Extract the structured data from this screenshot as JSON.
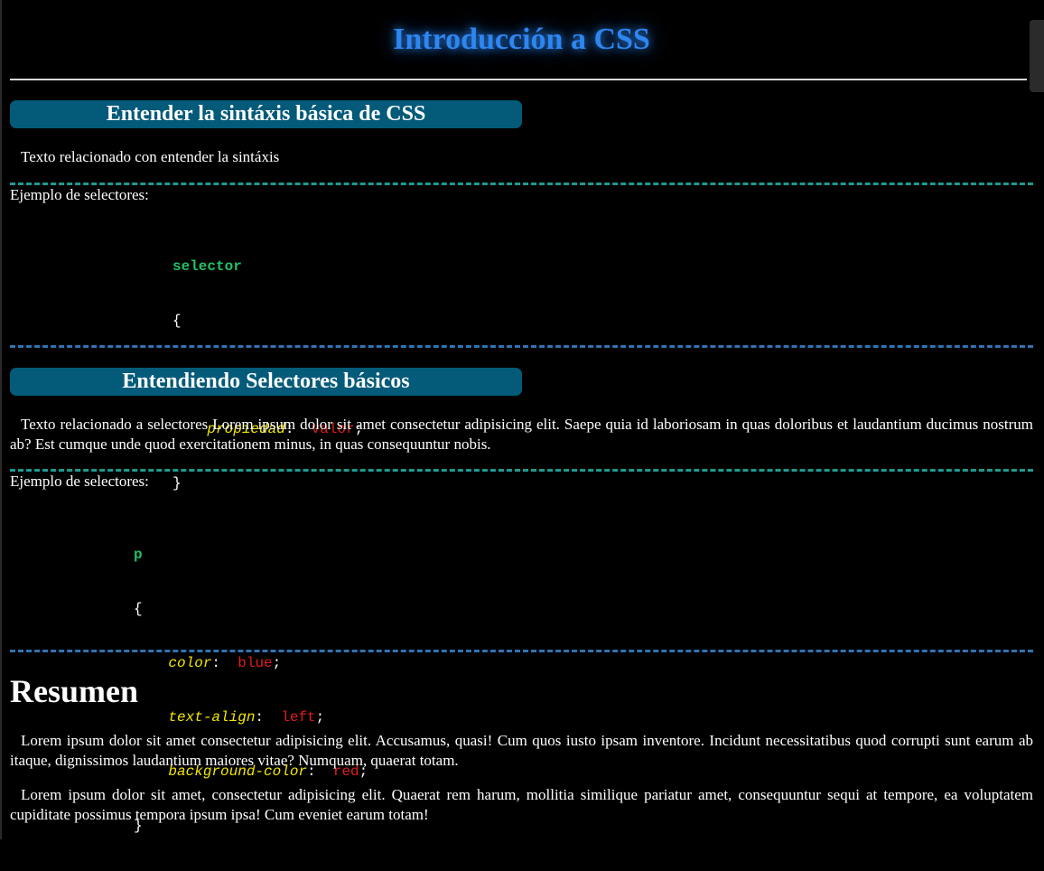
{
  "page": {
    "title": "Introducción a CSS"
  },
  "section1": {
    "heading": "Entender la sintáxis básica de CSS",
    "text": "Texto relacionado con entender la sintáxis",
    "example_label": "Ejemplo de selectores:",
    "code": {
      "selector": "selector",
      "open_brace": "{",
      "close_brace": "}",
      "declarations": [
        {
          "property": "propiedad",
          "value": "valor"
        },
        {
          "property": "propiedad",
          "value": "valor"
        }
      ]
    }
  },
  "section2": {
    "heading": "Entendiendo Selectores básicos",
    "text": "Texto relacionado a selectores Lorem ipsum dolor sit amet consectetur adipisicing elit. Saepe quia id laboriosam in quas doloribus et laudantium ducimus nostrum ab? Est cumque unde quod exercitationem minus, in quas consequuntur nobis.",
    "example_label": "Ejemplo de selectores:",
    "code": {
      "selector": "p",
      "open_brace": "{",
      "close_brace": "}",
      "declarations": [
        {
          "property": "color",
          "value": "blue"
        },
        {
          "property": "text-align",
          "value": "left"
        },
        {
          "property": "background-color",
          "value": "red"
        }
      ]
    }
  },
  "summary": {
    "heading": "Resumen",
    "paragraphs": [
      "Lorem ipsum dolor sit amet consectetur adipisicing elit. Accusamus, quasi! Cum quos iusto ipsam inventore. Incidunt necessitatibus quod corrupti sunt earum ab itaque, dignissimos laudantium maiores vitae? Numquam, quaerat totam.",
      "Lorem ipsum dolor sit amet, consectetur adipisicing elit. Quaerat rem harum, mollitia similique pariatur amet, consequuntur sequi at tempore, ea voluptatem cupiditate possimus tempora ipsum ipsa! Cum eveniet earum totam!"
    ]
  },
  "colors": {
    "title": "#2e86f0",
    "section_heading_bg": "#035a79",
    "divider_green": "#1e9a92",
    "divider_blue": "#2f73b0",
    "code_selector": "#22c065",
    "code_property": "#f2e600",
    "code_value": "#e21b1b"
  }
}
